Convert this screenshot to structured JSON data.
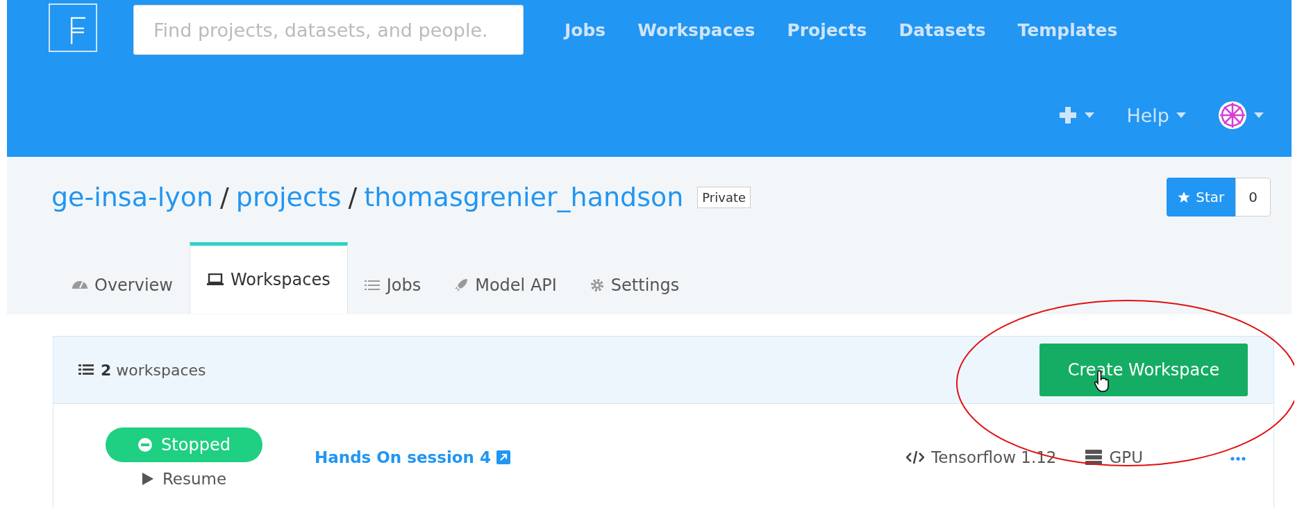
{
  "header": {
    "search": {
      "placeholder": "Find projects, datasets, and people."
    },
    "nav": [
      "Jobs",
      "Workspaces",
      "Projects",
      "Datasets",
      "Templates"
    ],
    "help": "Help"
  },
  "breadcrumb": {
    "items": [
      "ge-insa-lyon",
      "projects",
      "thomasgrenier_handson"
    ],
    "separators": [
      "/",
      "/"
    ]
  },
  "visibility": "Private",
  "star": {
    "label": "Star",
    "count": "0"
  },
  "tabs": [
    {
      "label": "Overview",
      "selected": false
    },
    {
      "label": "Workspaces",
      "selected": true
    },
    {
      "label": "Jobs",
      "selected": false
    },
    {
      "label": "Model API",
      "selected": false
    },
    {
      "label": "Settings",
      "selected": false
    }
  ],
  "workspaces": {
    "count": "2",
    "count_label": "workspaces",
    "create_button": "Create Workspace",
    "rows": [
      {
        "status": "Stopped",
        "action": "Resume",
        "name": "Hands On session 4",
        "environment": "Tensorflow 1.12",
        "machine": "GPU"
      }
    ]
  }
}
